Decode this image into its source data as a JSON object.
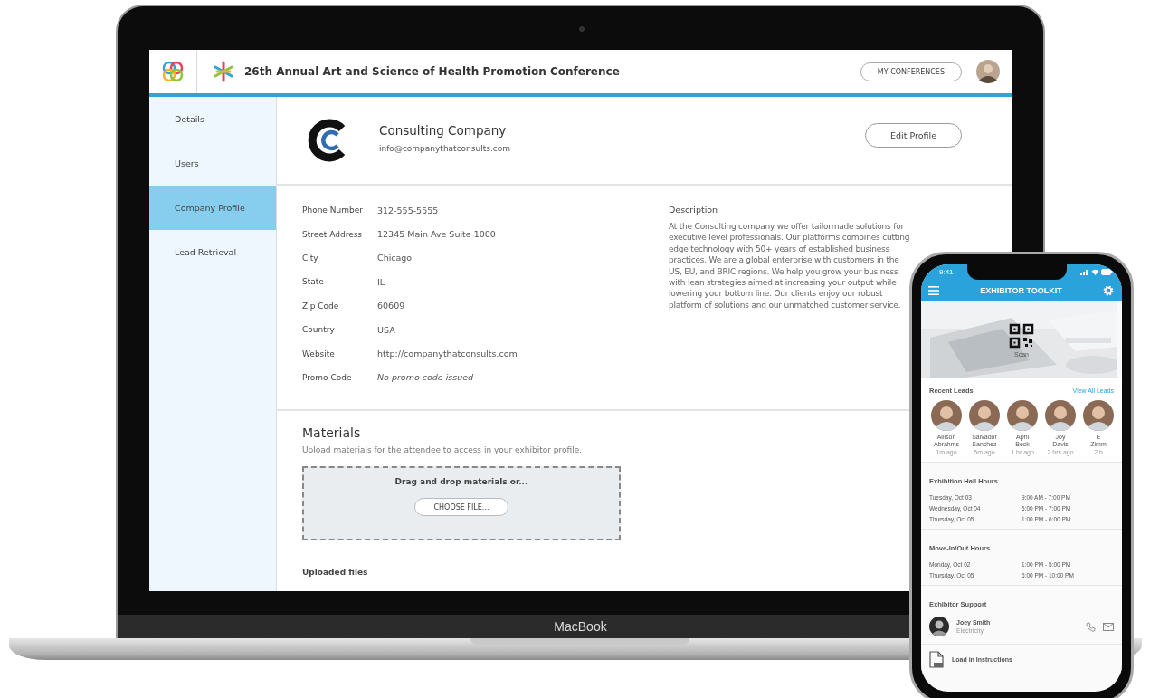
{
  "laptop": {
    "header": {
      "title": "26th Annual Art and Science of Health Promotion Conference",
      "conferences_button": "MY CONFERENCES"
    },
    "sidebar": {
      "items": [
        {
          "label": "Details",
          "selected": false
        },
        {
          "label": "Users",
          "selected": false
        },
        {
          "label": "Company Profile",
          "selected": true
        },
        {
          "label": "Lead Retrieval",
          "selected": false
        }
      ]
    },
    "profile": {
      "name": "Consulting Company",
      "email": "info@companythatconsults.com",
      "edit_button": "Edit Profile"
    },
    "details": [
      {
        "label": "Phone Number",
        "value": "312-555-5555",
        "kind": "text"
      },
      {
        "label": "Street Address",
        "value": "12345 Main Ave Suite 1000",
        "kind": "text"
      },
      {
        "label": "City",
        "value": "Chicago",
        "kind": "text"
      },
      {
        "label": "State",
        "value": "IL",
        "kind": "text"
      },
      {
        "label": "Zip Code",
        "value": "60609",
        "kind": "text"
      },
      {
        "label": "Country",
        "value": "USA",
        "kind": "text"
      },
      {
        "label": "Website",
        "value": "http://companythatconsults.com",
        "kind": "text"
      },
      {
        "label": "Promo Code",
        "value": "No promo code issued",
        "kind": "note"
      }
    ],
    "description": {
      "heading": "Description",
      "text": "At the Consulting company we offer tailormade solutions for executive level professionals. Our platforms combines cutting edge technology with 50+ years of established business practices. We are a global enterprise with customers in the US, EU, and BRIC regions. We help you grow your business with lean strategies aimed at increasing your output while lowering your bottom line. Our clients enjoy our robust platform of solutions and our unmatched customer service."
    },
    "materials": {
      "heading": "Materials",
      "hint": "Upload materials for the attendee to access in your exhibitor profile.",
      "drop_text": "Drag and drop materials or...",
      "choose_button": "CHOOSE FILE...",
      "uploaded_heading": "Uploaded files"
    },
    "device_label": "MacBook"
  },
  "phone": {
    "time": "9:41",
    "title": "EXHIBITOR TOOLKIT",
    "scan_label": "Scan",
    "recent_leads": {
      "heading": "Recent Leads",
      "link": "View All Leads",
      "leads": [
        {
          "first": "Allison",
          "last": "Abrahms",
          "time": "1m ago"
        },
        {
          "first": "Salvador",
          "last": "Sanchez",
          "time": "5m ago"
        },
        {
          "first": "April",
          "last": "Beck",
          "time": "1 hr ago"
        },
        {
          "first": "Joy",
          "last": "Davis",
          "time": "2 hrs ago"
        },
        {
          "first": "E",
          "last": "Zimm",
          "time": "2 h"
        }
      ]
    },
    "hour_sections": [
      {
        "heading": "Exhibition Hall Hours",
        "rows": [
          {
            "day": "Tuesday, Oct 03",
            "hours": "9:00 AM - 7:00 PM"
          },
          {
            "day": "Wednesday, Oct 04",
            "hours": "5:00 PM - 7:00 PM"
          },
          {
            "day": "Thursday, Oct 05",
            "hours": "1:00 PM - 6:00 PM"
          }
        ]
      },
      {
        "heading": "Move-In/Out Hours",
        "rows": [
          {
            "day": "Monday, Oct 02",
            "hours": "1:00 PM - 5:00 PM"
          },
          {
            "day": "Thursday, Oct 05",
            "hours": "6:00 PM - 10:00 PM"
          }
        ]
      }
    ],
    "support": {
      "heading": "Exhibitor Support",
      "contact_name": "Joey Smith",
      "contact_role": "Electricity"
    },
    "document": "Load in Instructions"
  }
}
